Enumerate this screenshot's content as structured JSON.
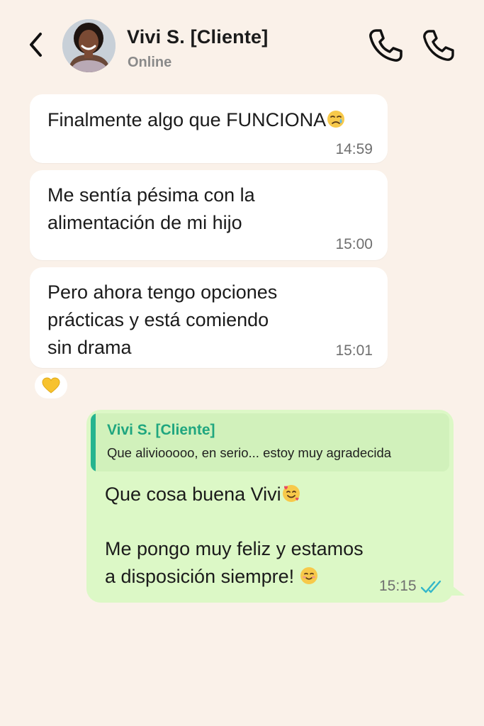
{
  "header": {
    "contact_name": "Vivi S. [Cliente]",
    "status": "Online",
    "icons": [
      "back-arrow-icon",
      "avatar",
      "phone-call-icon",
      "phone-call-icon"
    ]
  },
  "messages_incoming": [
    {
      "text": "Finalmente algo que FUNCIONA",
      "emoji": "crying-face-emoji",
      "time": "14:59"
    },
    {
      "line1": "Me sentía pésima con la",
      "line2": "alimentación de mi hijo",
      "time": "15:00"
    },
    {
      "line1": "Pero ahora tengo opciones",
      "line2": "prácticas y está comiendo",
      "line3": "sin drama",
      "time": "15:01"
    }
  ],
  "reaction": {
    "emoji": "yellow-heart-emoji"
  },
  "reply": {
    "quoted_author": "Vivi S. [Cliente]",
    "quoted_text": "Que aliviooooo, en serio... estoy muy agradecida",
    "line1": "Que cosa buena Vivi",
    "line2": "Me pongo muy feliz y estamos",
    "line3": "a disposición siempre!",
    "time": "15:15",
    "status": "read-double-check-icon"
  },
  "colors": {
    "background": "#faf1e9",
    "incoming_bubble": "#ffffff",
    "outgoing_bubble": "#dcf8c6",
    "quote_accent": "#25b48f",
    "read_ticks": "#34b7c9"
  }
}
